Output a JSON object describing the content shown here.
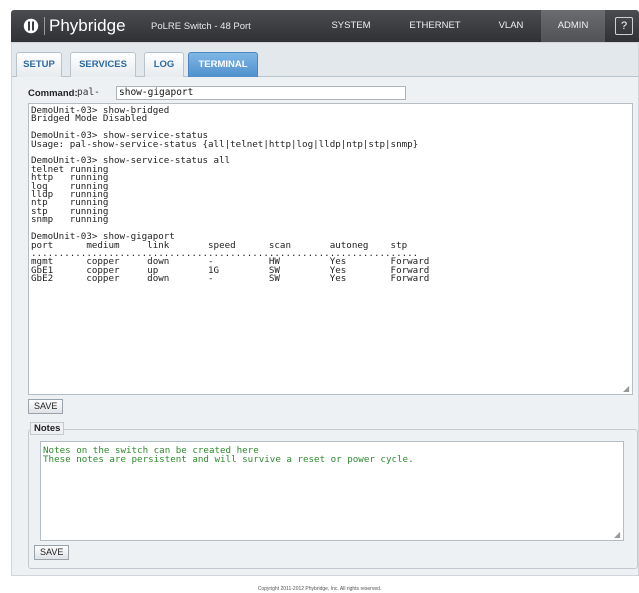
{
  "header": {
    "brand": "Phybridge",
    "product": "PoLRE Switch - 48 Port",
    "nav": [
      "SYSTEM",
      "ETHERNET",
      "VLAN",
      "ADMIN"
    ],
    "active_nav": "ADMIN",
    "help": "?",
    "colors": {
      "bar": "#3a3c40",
      "active_tab": "#5c9ad3"
    }
  },
  "tabs": [
    "SETUP",
    "SERVICES",
    "LOG",
    "TERMINAL"
  ],
  "active_tab": "TERMINAL",
  "command": {
    "label": "Command:",
    "prefix": "pal-",
    "value": "show-gigaport"
  },
  "terminal": {
    "output": "DemoUnit-03> show-bridged\nBridged Mode Disabled\n\nDemoUnit-03> show-service-status\nUsage: pal-show-service-status {all|telnet|http|log|lldp|ntp|stp|snmp}\n\nDemoUnit-03> show-service-status all\ntelnet running\nhttp   running\nlog    running\nlldp   running\nntp    running\nstp    running\nsnmp   running\n\nDemoUnit-03> show-gigaport\nport      medium     link       speed      scan       autoneg    stp\n......................................................................\nmgmt      copper     down       -          HW         Yes        Forward\nGbE1      copper     up         1G         SW         Yes        Forward\nGbE2      copper     down       -          SW         Yes        Forward"
  },
  "save_label": "SAVE",
  "notes": {
    "legend": "Notes",
    "text": "Notes on the switch can be created here\nThese notes are persistent and will survive a reset or power cycle.",
    "save_label": "SAVE"
  },
  "footer": "Copyright 2011-2012 Phybridge, Inc. All rights reserved."
}
